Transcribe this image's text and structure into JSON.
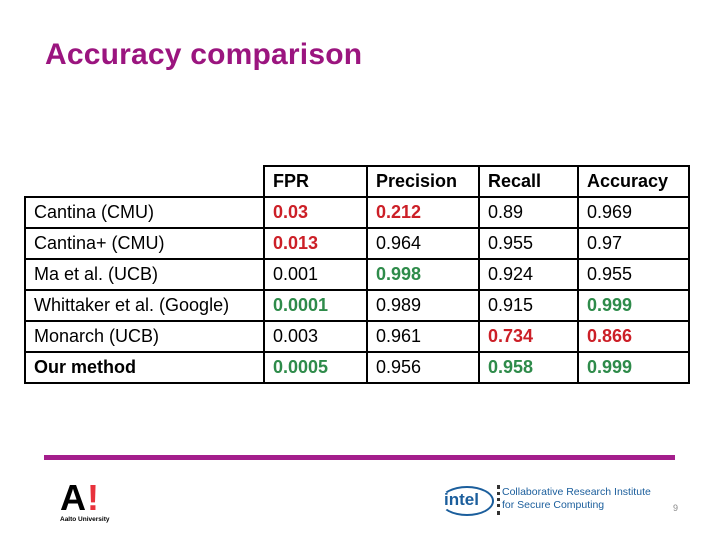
{
  "slide": {
    "title": "Accuracy comparison",
    "page_number": "9"
  },
  "table": {
    "headers": [
      "",
      "FPR",
      "Precision",
      "Recall",
      "Accuracy"
    ],
    "rows": [
      {
        "method": "Cantina (CMU)",
        "method_bold": false,
        "cells": [
          {
            "value": "0.03",
            "style": "red"
          },
          {
            "value": "0.212",
            "style": "red"
          },
          {
            "value": "0.89",
            "style": "normal"
          },
          {
            "value": "0.969",
            "style": "normal"
          }
        ]
      },
      {
        "method": "Cantina+ (CMU)",
        "method_bold": false,
        "cells": [
          {
            "value": "0.013",
            "style": "red"
          },
          {
            "value": "0.964",
            "style": "normal"
          },
          {
            "value": "0.955",
            "style": "normal"
          },
          {
            "value": "0.97",
            "style": "normal"
          }
        ]
      },
      {
        "method": "Ma et al. (UCB)",
        "method_bold": false,
        "cells": [
          {
            "value": "0.001",
            "style": "normal"
          },
          {
            "value": "0.998",
            "style": "green"
          },
          {
            "value": "0.924",
            "style": "normal"
          },
          {
            "value": "0.955",
            "style": "normal"
          }
        ]
      },
      {
        "method": "Whittaker et al. (Google)",
        "method_bold": false,
        "cells": [
          {
            "value": "0.0001",
            "style": "green"
          },
          {
            "value": "0.989",
            "style": "normal"
          },
          {
            "value": "0.915",
            "style": "normal"
          },
          {
            "value": "0.999",
            "style": "green"
          }
        ]
      },
      {
        "method": "Monarch (UCB)",
        "method_bold": false,
        "cells": [
          {
            "value": "0.003",
            "style": "normal"
          },
          {
            "value": "0.961",
            "style": "normal"
          },
          {
            "value": "0.734",
            "style": "red"
          },
          {
            "value": "0.866",
            "style": "red"
          }
        ]
      },
      {
        "method": "Our method",
        "method_bold": true,
        "cells": [
          {
            "value": "0.0005",
            "style": "green"
          },
          {
            "value": "0.956",
            "style": "normal"
          },
          {
            "value": "0.958",
            "style": "green"
          },
          {
            "value": "0.999",
            "style": "green"
          }
        ]
      }
    ]
  },
  "colors": {
    "title": "#9b157f",
    "rule": "#a41e8c",
    "worst": "#cc1f27",
    "best": "#2e8b4a"
  },
  "footer": {
    "aalto_logo_mark": "A!",
    "aalto_name": "Aalto University",
    "intel_logo_text": "intel",
    "institute_line1": "Collaborative Research Institute",
    "institute_line2": "for Secure Computing"
  }
}
